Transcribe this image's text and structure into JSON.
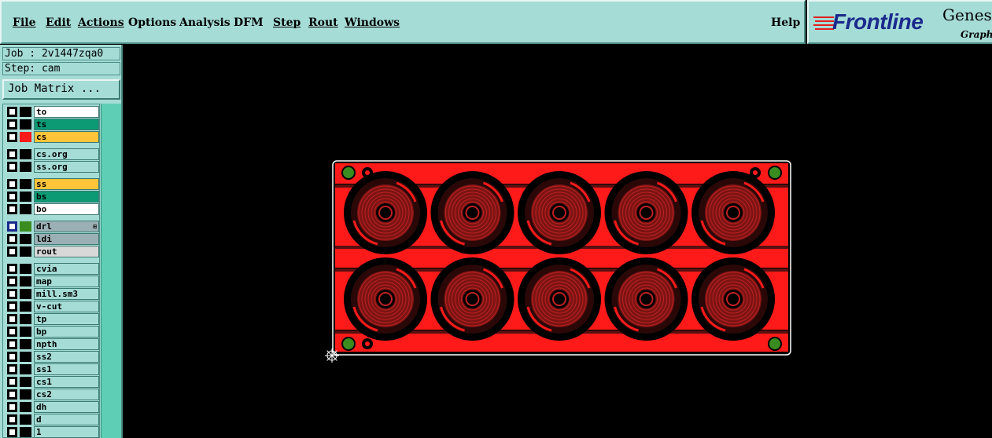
{
  "menu": {
    "file": "File",
    "edit": "Edit",
    "actions": "Actions",
    "options": "Options",
    "analysis": "Analysis",
    "dfm": "DFM",
    "step": "Step",
    "rout": "Rout",
    "windows": "Windows",
    "help": "Help"
  },
  "logo": {
    "brand": "Frontline",
    "product": "Genes",
    "subtitle": "Graphi"
  },
  "job_panel": {
    "job": "Job : 2v1447zqa0",
    "step": "Step: cam",
    "job_matrix": "Job Matrix ..."
  },
  "layers": [
    {
      "name": "to",
      "color": "#ffffff"
    },
    {
      "name": "ts",
      "color": "#0c9a74"
    },
    {
      "name": "cs",
      "color": "#ffc43a",
      "swatch": "#ff1a1a"
    },
    {
      "name": "cs.org",
      "color": "#a5dcd6"
    },
    {
      "name": "ss.org",
      "color": "#a5dcd6"
    },
    {
      "name": "ss",
      "color": "#ffc43a"
    },
    {
      "name": "bs",
      "color": "#0c9a74"
    },
    {
      "name": "bo",
      "color": "#ffffff"
    },
    {
      "name": "drl",
      "color": "#9bb0b4",
      "swatch": "#3a8c20",
      "selected": true
    },
    {
      "name": "ldi",
      "color": "#9bb0b4"
    },
    {
      "name": "rout",
      "color": "#d8d8d8"
    },
    {
      "name": "cvia",
      "color": "#a5dcd6"
    },
    {
      "name": "map",
      "color": "#a5dcd6"
    },
    {
      "name": "mill.sm3",
      "color": "#a5dcd6"
    },
    {
      "name": "v-cut",
      "color": "#a5dcd6"
    },
    {
      "name": "tp",
      "color": "#a5dcd6"
    },
    {
      "name": "bp",
      "color": "#a5dcd6"
    },
    {
      "name": "npth",
      "color": "#a5dcd6"
    },
    {
      "name": "ss2",
      "color": "#a5dcd6"
    },
    {
      "name": "ss1",
      "color": "#a5dcd6"
    },
    {
      "name": "cs1",
      "color": "#a5dcd6"
    },
    {
      "name": "cs2",
      "color": "#a5dcd6"
    },
    {
      "name": "dh",
      "color": "#a5dcd6"
    },
    {
      "name": "d",
      "color": "#a5dcd6"
    },
    {
      "name": "1",
      "color": "#a5dcd6"
    }
  ],
  "board": {
    "rows": 2,
    "cols": 5,
    "copper_color": "#ff1a1a",
    "pad_color": "#3a8c20",
    "outline_color": "#ffffff"
  }
}
